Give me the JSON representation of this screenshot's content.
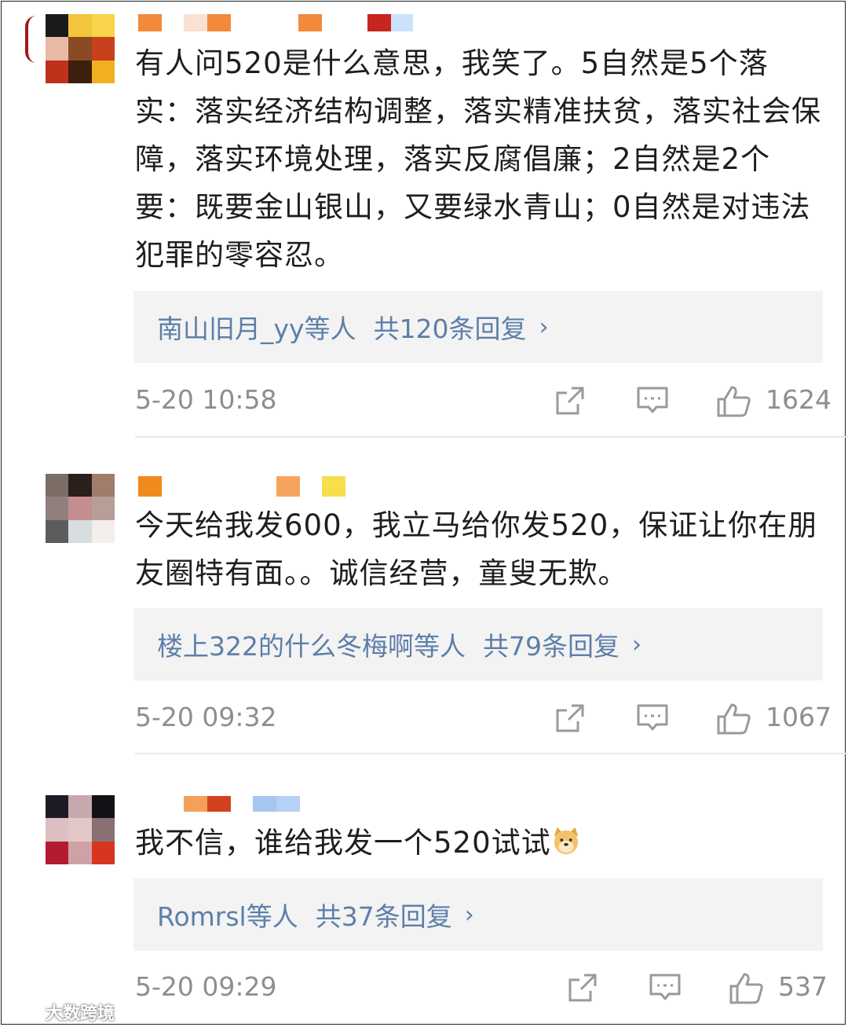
{
  "comments": [
    {
      "text": "有人问520是什么意思，我笑了。5自然是5个落实：落实经济结构调整，落实精准扶贫，落实社会保障，落实环境处理，落实反腐倡廉；2自然是2个要：既要金山银山，又要绿水青山；0自然是对违法犯罪的零容忍。",
      "replies_names": "南山旧月_yy等人",
      "replies_count": "共120条回复",
      "chevron": "›",
      "time": "5-20 10:58",
      "likes": "1624"
    },
    {
      "text": "今天给我发600，我立马给你发520，保证让你在朋友圈特有面。。诚信经营，童叟无欺。",
      "replies_names": "楼上322的什么冬梅啊等人",
      "replies_count": "共79条回复",
      "chevron": "›",
      "time": "5-20 09:32",
      "likes": "1067"
    },
    {
      "text": "我不信，谁给我发一个520试试",
      "emoji": "doge-emoji",
      "replies_names": "Romrsl等人",
      "replies_count": "共37条回复",
      "chevron": "›",
      "time": "5-20 09:29",
      "likes": "537"
    }
  ],
  "icons": {
    "share": "share-icon",
    "comment": "comment-icon",
    "like": "thumbs-up-icon"
  },
  "colors": {
    "link": "#5d7fa9",
    "meta": "#8e8e8e",
    "reply_bg": "#f3f3f3"
  },
  "watermark": "大数跨境"
}
